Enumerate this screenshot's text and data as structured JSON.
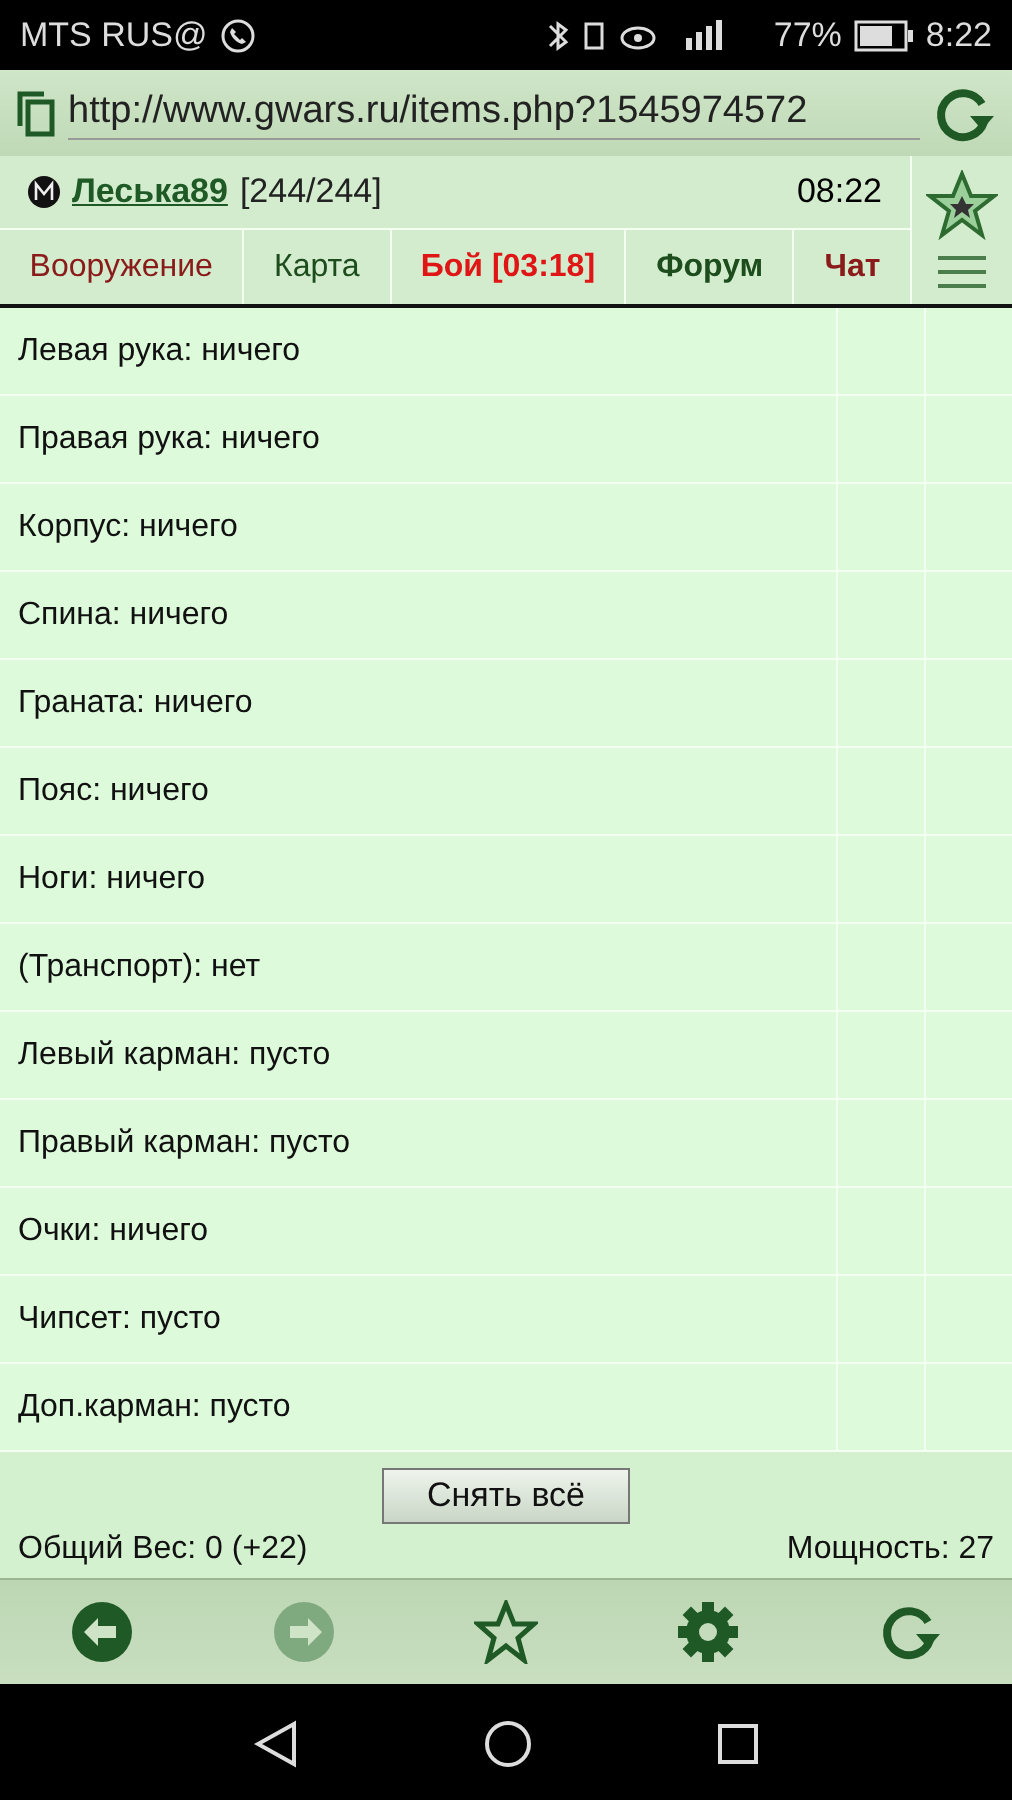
{
  "status_bar": {
    "carrier": "MTS RUS@",
    "battery": "77%",
    "time": "8:22"
  },
  "address_bar": {
    "url": "http://www.gwars.ru/items.php?1545974572"
  },
  "header": {
    "user": "Леська89",
    "hp": "[244/244]",
    "time": "08:22"
  },
  "tabs": [
    {
      "label": "Вооружение",
      "color": "#8b1a1a",
      "bold": false
    },
    {
      "label": "Карта",
      "color": "#1d4d1d",
      "bold": false
    },
    {
      "label": "Бой [03:18]",
      "color": "#e01515",
      "bold": true
    },
    {
      "label": "Форум",
      "color": "#1d4d1d",
      "bold": true
    },
    {
      "label": "Чат",
      "color": "#8b1a1a",
      "bold": true
    }
  ],
  "slots": [
    "Левая рука: ничего",
    "Правая рука: ничего",
    "Корпус: ничего",
    "Спина: ничего",
    "Граната: ничего",
    "Пояс: ничего",
    "Ноги: ничего",
    "(Транспорт): нет",
    "Левый карман: пусто",
    "Правый карман: пусто",
    "Очки: ничего",
    "Чипсет: пусто",
    "Доп.карман: пусто"
  ],
  "footer": {
    "button": "Снять всё",
    "weight": "Общий Вес: 0 (+22)",
    "power": "Мощность: 27"
  },
  "toolbar": [
    {
      "kind": "back",
      "disabled": false
    },
    {
      "kind": "forward",
      "disabled": true
    },
    {
      "kind": "star",
      "disabled": false
    },
    {
      "kind": "settings",
      "disabled": false
    },
    {
      "kind": "reload",
      "disabled": false
    }
  ]
}
